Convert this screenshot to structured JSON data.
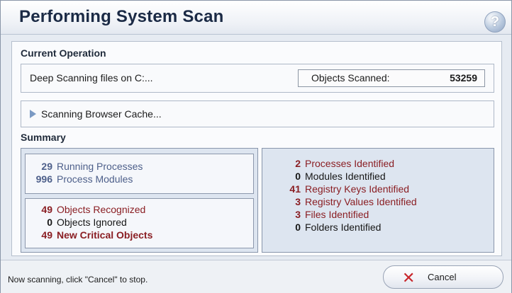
{
  "header": {
    "title": "Performing System Scan",
    "help_icon": "?"
  },
  "current_operation": {
    "title": "Current Operation",
    "text": "Deep Scanning files on C:...",
    "objects_scanned_label": "Objects Scanned:",
    "objects_scanned_value": "53259",
    "sub_status": "Scanning Browser Cache..."
  },
  "summary": {
    "title": "Summary",
    "processes": [
      {
        "num": "29",
        "label": "Running Processes"
      },
      {
        "num": "996",
        "label": "Process Modules"
      }
    ],
    "objects": [
      {
        "num": "49",
        "label": "Objects Recognized"
      },
      {
        "num": "0",
        "label": "Objects Ignored"
      },
      {
        "num": "49",
        "label": "New Critical Objects"
      }
    ],
    "identified": [
      {
        "num": "2",
        "label": "Processes Identified"
      },
      {
        "num": "0",
        "label": "Modules Identified"
      },
      {
        "num": "41",
        "label": "Registry Keys Identified"
      },
      {
        "num": "3",
        "label": "Registry Values Identified"
      },
      {
        "num": "3",
        "label": "Files Identified"
      },
      {
        "num": "0",
        "label": "Folders Identified"
      }
    ]
  },
  "footer": {
    "status": "Now scanning, click \"Cancel\" to stop.",
    "cancel_label": "Cancel",
    "cancel_icon": "✕"
  },
  "colors": {
    "accent_blue": "#4d5f8a",
    "alert_red": "#8a1e23",
    "cancel_red": "#c8262b"
  }
}
